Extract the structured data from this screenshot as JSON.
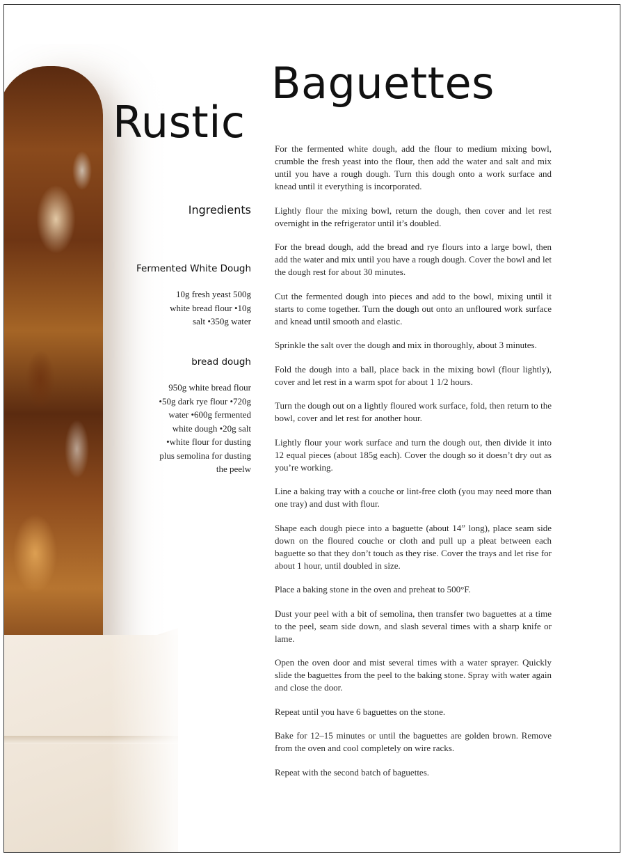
{
  "title": {
    "line1": "Baguettes",
    "line2": "Rustic"
  },
  "ingredients": {
    "heading": "Ingredients",
    "sections": [
      {
        "title": "Fermented White Dough",
        "text": "10g fresh yeast 500g white bread flour •10g salt •350g water"
      },
      {
        "title": "bread dough",
        "text": "950g white bread flour •50g dark rye flour •720g water •600g fermented white dough •20g salt •white flour for dusting plus semolina for dusting the peelw"
      }
    ]
  },
  "method": {
    "steps": [
      "For the fermented white dough, add the flour to medium mixing bowl, crumble the fresh yeast into the flour, then add the water and salt and mix until you have a rough dough. Turn this dough onto a work surface and knead until it everything is incorporated.",
      "Lightly flour the mixing bowl, return the dough, then cover and let rest overnight in the refrigerator until it’s doubled.",
      "For the bread dough, add the bread and rye flours into a large bowl, then add the water and mix until you have a rough dough. Cover the bowl and let the dough rest for about 30 minutes.",
      "Cut the fermented dough into pieces and add to the bowl, mixing until it starts to come together. Turn the dough out onto an unfloured work surface and knead until smooth and elastic.",
      "Sprinkle the salt over the dough and mix in thoroughly, about 3 minutes.",
      "Fold the dough into a ball, place back in the mixing bowl (flour lightly), cover and let rest in a warm spot for about 1 1/2 hours.",
      "Turn the dough out on a lightly floured work surface, fold, then return to the bowl, cover and let rest for another hour.",
      "Lightly flour your work surface and turn the dough out, then divide it into 12 equal pieces (about 185g each). Cover the dough so it doesn’t dry out as you’re working.",
      "Line a baking tray with a couche or lint-free cloth (you may need more than one tray) and dust with flour.",
      "Shape each dough piece into a baguette (about 14” long), place seam side down on the floured couche or cloth and pull up a pleat between each baguette so that they don’t touch as they rise. Cover the trays and let rise for about 1 hour, until doubled in size.",
      "Place a baking stone in the oven and preheat to 500°F.",
      "Dust your peel with a bit of semolina, then transfer two baguettes at a time to the peel, seam side down, and slash several times with a sharp knife or lame.",
      "Open the oven door and mist several times with a water sprayer. Quickly slide the baguettes from the peel to the baking stone. Spray with water again and close the door.",
      "Repeat until you have 6 baguettes on the stone.",
      "Bake for 12–15 minutes or until the baguettes are golden brown. Remove from the oven and cool completely on wire racks.",
      "Repeat with the second batch of baguettes."
    ]
  }
}
